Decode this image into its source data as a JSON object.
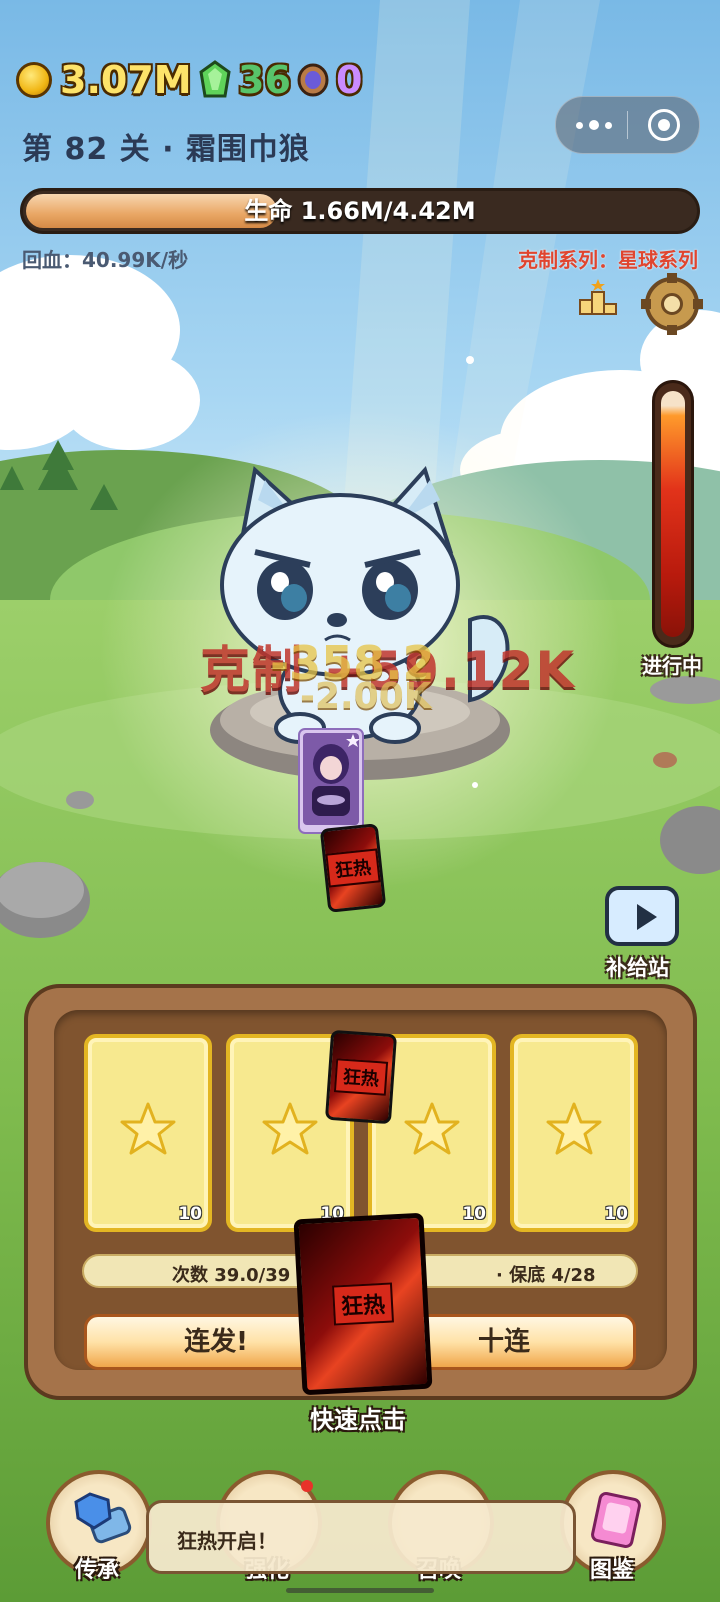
{
  "currency": {
    "gold": "3.07M",
    "gems": "36",
    "tokens": "0"
  },
  "stage": {
    "title": "第 82 关 · 霜围巾狼",
    "hp_text": "生命 1.66M/4.42M",
    "hp_fraction": 0.376,
    "regen": "回血：40.99K/秒",
    "counter": "克制系列：星球系列"
  },
  "progress": {
    "label": "进行中"
  },
  "floating_text": {
    "counter_hit": "克制 +59.12K",
    "damage_1": "-358.2",
    "damage_2": "-2.00K"
  },
  "mini_card_label": "狂热",
  "supply": {
    "label": "补给站"
  },
  "draw_panel": {
    "cards": [
      {
        "count": "10"
      },
      {
        "count": "10"
      },
      {
        "count": "10"
      },
      {
        "count": "10"
      }
    ],
    "count_left": "次数 39.0/39",
    "count_right": "· 保底 4/28",
    "burst_button": "连发!",
    "ten_button": "十连",
    "fever_label": "狂热",
    "quick_tap": "快速点击"
  },
  "nav": [
    {
      "label": "传承"
    },
    {
      "label": "强化"
    },
    {
      "label": "召唤"
    },
    {
      "label": "图鉴"
    }
  ],
  "toast": {
    "text": "狂热开启！"
  },
  "colors": {
    "gold": "#fde36a",
    "gem_green": "#58c46a",
    "token_purple": "#c98cff",
    "counter_red": "#e0452f",
    "panel_wood": "#a5734a"
  }
}
